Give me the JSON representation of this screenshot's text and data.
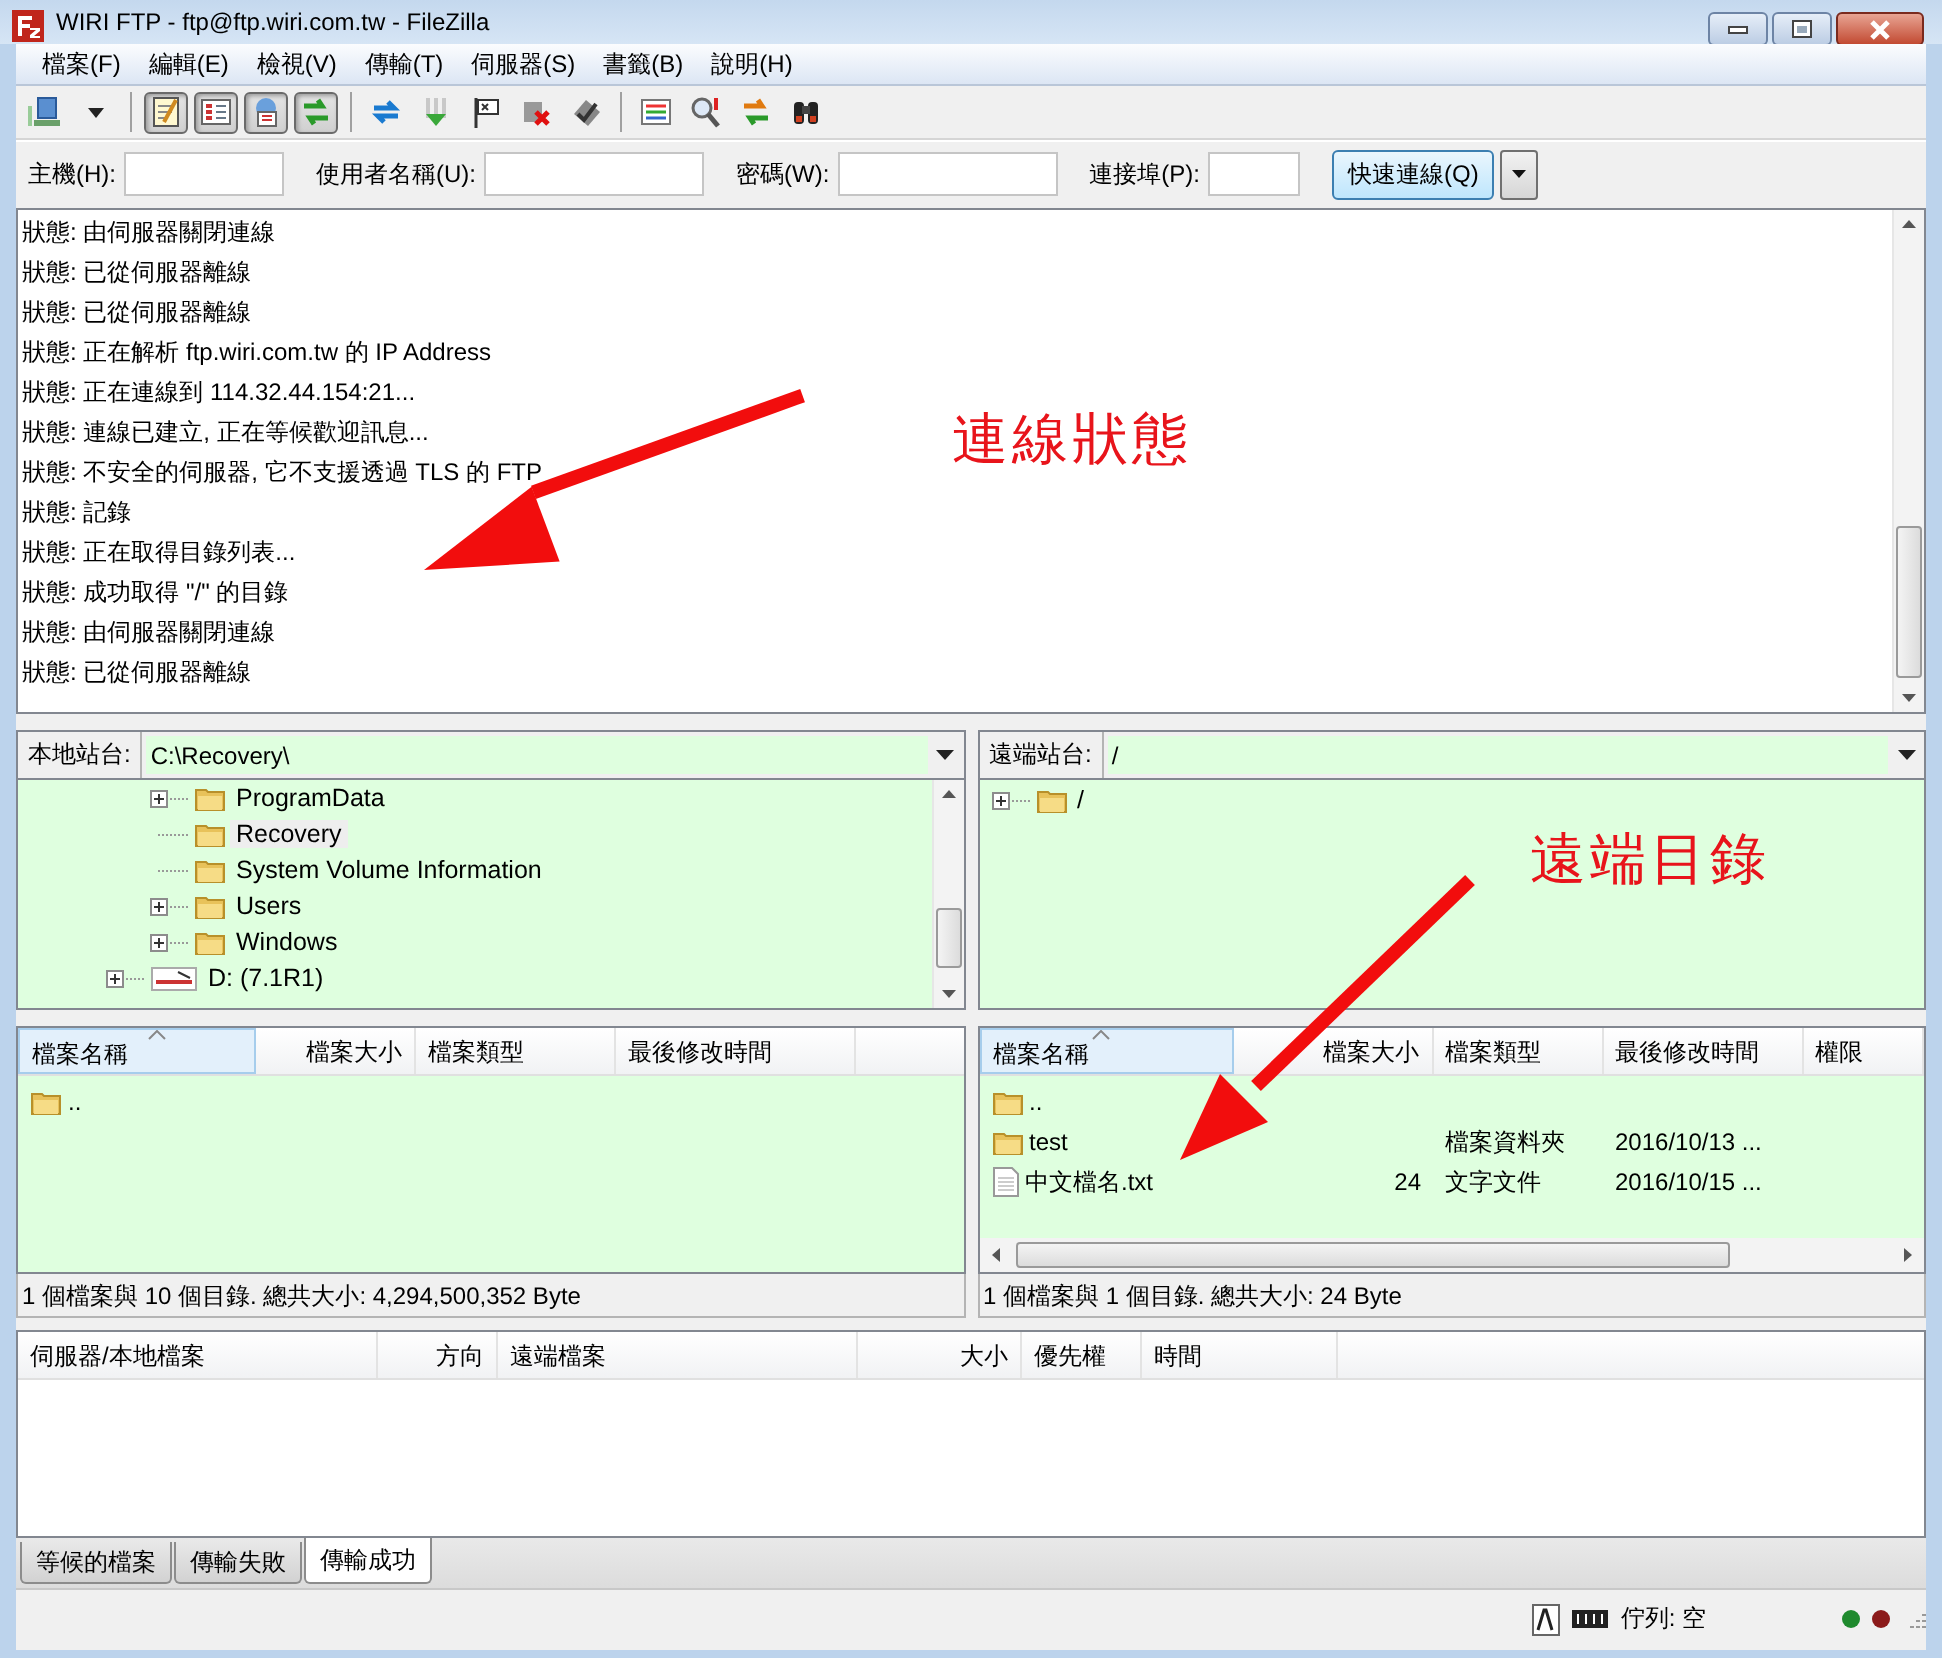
{
  "window": {
    "title": "WIRI FTP - ftp@ftp.wiri.com.tw - FileZilla"
  },
  "menu": [
    "檔案(F)",
    "編輯(E)",
    "檢視(V)",
    "傳輸(T)",
    "伺服器(S)",
    "書籤(B)",
    "說明(H)"
  ],
  "toolbar": {
    "toggle_buttons": [
      {
        "pressed": true
      },
      {
        "pressed": true
      },
      {
        "pressed": true
      },
      {
        "pressed": true
      }
    ]
  },
  "quickconnect": {
    "fields": [
      {
        "label": "主機(H):"
      },
      {
        "label": "使用者名稱(U):"
      },
      {
        "label": "密碼(W):"
      },
      {
        "label": "連接埠(P):"
      }
    ],
    "button": "快速連線(Q)"
  },
  "log": [
    "狀態: 由伺服器關閉連線",
    "狀態: 已從伺服器離線",
    "狀態: 已從伺服器離線",
    "狀態: 正在解析 ftp.wiri.com.tw 的 IP Address",
    "狀態: 正在連線到 114.32.44.154:21...",
    "狀態: 連線已建立, 正在等候歡迎訊息...",
    "狀態: 不安全的伺服器, 它不支援透過 TLS 的 FTP",
    "狀態: 記錄",
    "狀態: 正在取得目錄列表...",
    "狀態: 成功取得 \"/\" 的目錄",
    "狀態: 由伺服器關閉連線",
    "狀態: 已從伺服器離線"
  ],
  "annotations": [
    {
      "text": "連線狀態"
    },
    {
      "text": "遠端目錄"
    }
  ],
  "local": {
    "site_label": "本地站台:",
    "path": "C:\\Recovery\\",
    "tree": [
      {
        "children": [
          {
            "label": "ProgramData",
            "kind": "folder",
            "expandable": true,
            "selected": false
          },
          {
            "label": "Recovery",
            "kind": "folder",
            "expandable": false,
            "selected": true
          },
          {
            "label": "System Volume Information",
            "kind": "folder",
            "expandable": false,
            "selected": false
          },
          {
            "label": "Users",
            "kind": "folder",
            "expandable": true,
            "selected": false
          },
          {
            "label": "Windows",
            "kind": "folder",
            "expandable": true,
            "selected": false
          }
        ]
      },
      {
        "label": "D: (7.1R1)",
        "kind": "drive",
        "expandable": true,
        "selected": false
      }
    ],
    "columns": [
      {
        "label": "檔案名稱",
        "sorted": true
      },
      {
        "label": "檔案大小",
        "sorted": false
      },
      {
        "label": "檔案類型",
        "sorted": false
      },
      {
        "label": "最後修改時間",
        "sorted": false
      }
    ],
    "rows": [
      {
        "kind": "folder",
        "name": ".."
      }
    ],
    "summary": "1 個檔案與 10 個目錄. 總共大小: 4,294,500,352 Byte"
  },
  "remote": {
    "site_label": "遠端站台:",
    "path": "/",
    "tree": [
      {
        "label": "/",
        "kind": "folder",
        "expandable": true,
        "selected": false
      }
    ],
    "columns": [
      {
        "label": "檔案名稱",
        "sorted": true
      },
      {
        "label": "檔案大小",
        "sorted": false
      },
      {
        "label": "檔案類型",
        "sorted": false
      },
      {
        "label": "最後修改時間",
        "sorted": false
      },
      {
        "label": "權限",
        "sorted": false
      }
    ],
    "rows": [
      {
        "kind": "folder",
        "name": ".."
      },
      {
        "kind": "folder",
        "name": "test",
        "type": "檔案資料夾",
        "modified": "2016/10/13 ..."
      },
      {
        "kind": "file",
        "name": "中文檔名.txt",
        "size": "24",
        "type": "文字文件",
        "modified": "2016/10/15 ..."
      }
    ],
    "summary": "1 個檔案與 1 個目錄. 總共大小: 24 Byte"
  },
  "queue": {
    "columns": [
      "伺服器/本地檔案",
      "方向",
      "遠端檔案",
      "大小",
      "優先權",
      "時間"
    ],
    "tabs": [
      {
        "label": "等候的檔案",
        "selected": false
      },
      {
        "label": "傳輸失敗",
        "selected": false
      },
      {
        "label": "傳輸成功",
        "selected": true
      }
    ]
  },
  "status_bar": {
    "queue": "佇列: 空",
    "leds": [
      {
        "color": "#1f8a2e"
      },
      {
        "color": "#8b1a1a"
      }
    ]
  }
}
